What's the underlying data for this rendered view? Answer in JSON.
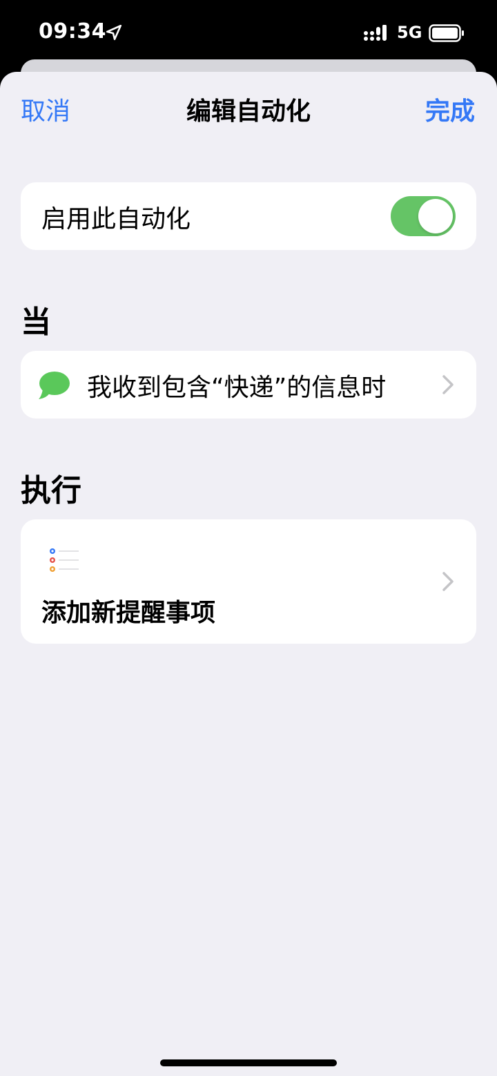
{
  "status": {
    "time": "09:34",
    "network": "5G",
    "icons": [
      "location-arrow-icon",
      "signal-bars-icon",
      "battery-icon"
    ]
  },
  "nav": {
    "cancel": "取消",
    "title": "编辑自动化",
    "done": "完成"
  },
  "toggle": {
    "label": "启用此自动化",
    "enabled": true
  },
  "when": {
    "header": "当",
    "trigger_text": "我收到包含“快递”的信息时",
    "icon": "message-bubble-icon"
  },
  "do": {
    "header": "执行",
    "action_text": "添加新提醒事项",
    "icon": "reminders-icon"
  },
  "colors": {
    "accent": "#3478f6",
    "switch_on": "#65c466",
    "background": "#f0eff5",
    "message_green": "#5ac85a"
  }
}
